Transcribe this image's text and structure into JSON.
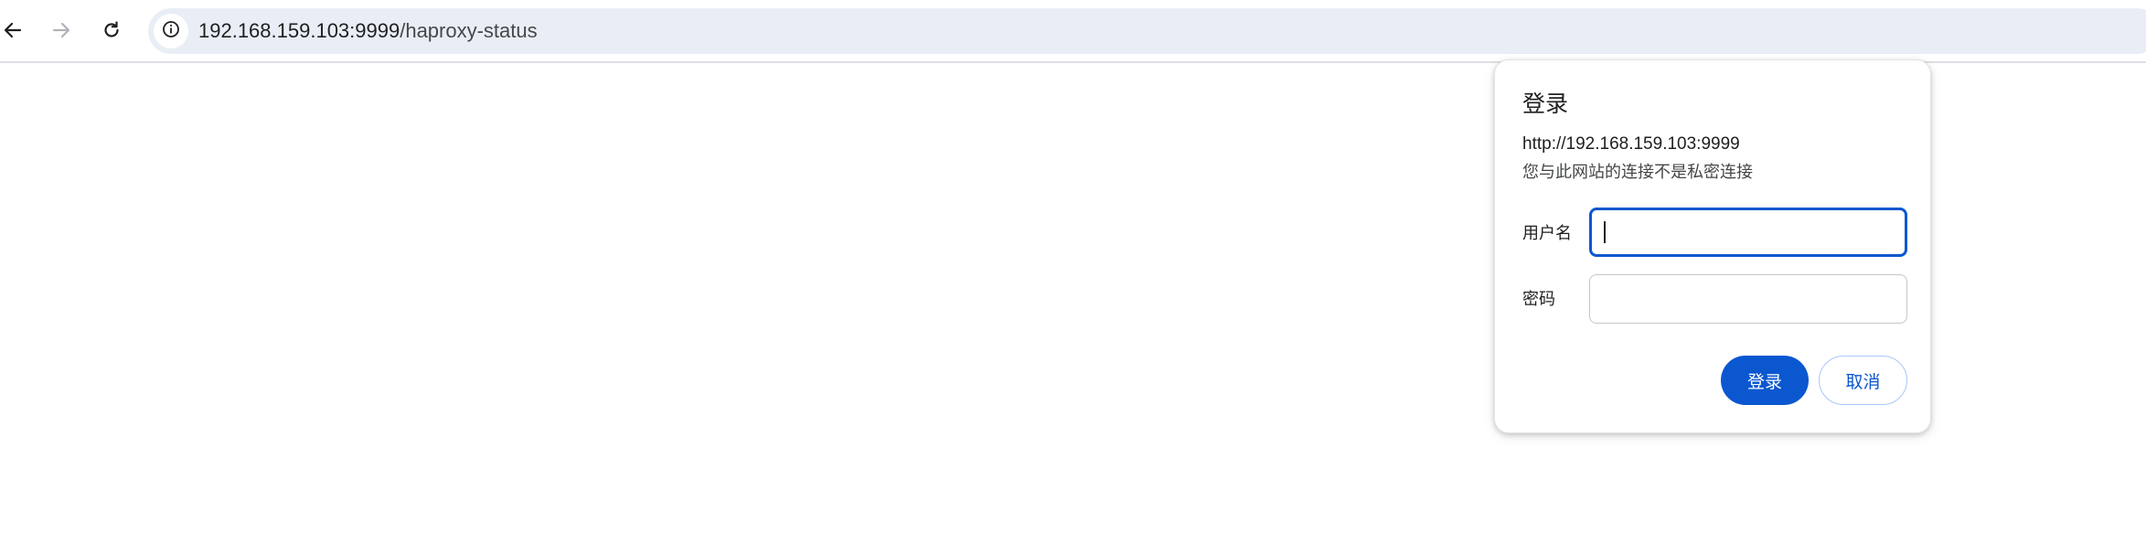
{
  "browser": {
    "back_icon": "arrow-left-icon",
    "forward_icon": "arrow-right-icon",
    "reload_icon": "reload-icon",
    "site_info_icon": "info-icon",
    "address_bar": {
      "host": "192.168.159.103:9999",
      "path": "/haproxy-status"
    },
    "colors": {
      "omnibox_bg": "#e9eef6",
      "forward_disabled": "#b0b3b8"
    }
  },
  "auth_dialog": {
    "title": "登录",
    "origin": "http://192.168.159.103:9999",
    "warning": "您与此网站的连接不是私密连接",
    "username_label": "用户名",
    "username_value": "",
    "password_label": "密码",
    "password_value": "",
    "submit_label": "登录",
    "cancel_label": "取消",
    "colors": {
      "accent": "#0b57d0",
      "secondary_border": "#a8c7fa"
    }
  }
}
